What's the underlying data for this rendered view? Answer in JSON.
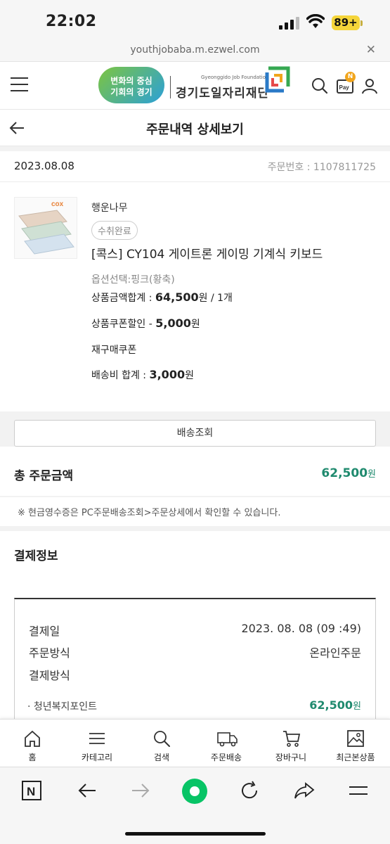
{
  "status_bar": {
    "time": "22:02",
    "battery": "89+"
  },
  "browser": {
    "url": "youthjobaba.m.ezwel.com",
    "close": "✕"
  },
  "header": {
    "logo_badge_line1": "변화의 중심",
    "logo_badge_line2": "기회의 경기",
    "logo_sub": "Gyeonggido Job Foundation",
    "logo_main": "경기도일자리재단",
    "pay_label": "Pay",
    "pay_badge": "N"
  },
  "page": {
    "title": "주문내역 상세보기"
  },
  "order": {
    "date": "2023.08.08",
    "number": "주문번호 : 1107811725"
  },
  "product": {
    "brand": "행운나무",
    "status": "수취완료",
    "thumb_logo": "cox",
    "name": "[콕스] CY104 게이트론 게이밍 기계식 키보드",
    "option": "옵션선택:핑크(황축)",
    "price_label": "상품금액합계 : ",
    "price_value": "64,500",
    "price_suffix": "원 / 1개",
    "coupon_label": "상품쿠폰할인 - ",
    "coupon_value": "5,000",
    "coupon_suffix": "원",
    "rebuy_coupon": "재구매쿠폰",
    "shipping_label": "배송비 합계 : ",
    "shipping_value": "3,000",
    "shipping_suffix": "원"
  },
  "shipping_button": "배송조회",
  "total": {
    "label": "총 주문금액",
    "value": "62,500",
    "unit": "원"
  },
  "notice": "※ 현금영수증은 PC주문배송조회>주문상세에서 확인할 수 있습니다.",
  "payment": {
    "title": "결제정보",
    "date_label": "결제일",
    "date_value": "2023. 08. 08 (09 :49)",
    "method_label": "주문방식",
    "method_value": "온라인주문",
    "pay_method_label": "결제방식",
    "point_label": "· 청년복지포인트",
    "point_value": "62,500",
    "point_unit": "원"
  },
  "bottom_nav": [
    {
      "label": "홈",
      "icon": "home-icon"
    },
    {
      "label": "카테고리",
      "icon": "menu-icon"
    },
    {
      "label": "검색",
      "icon": "search-icon"
    },
    {
      "label": "주문배송",
      "icon": "truck-icon"
    },
    {
      "label": "장바구니",
      "icon": "cart-icon"
    },
    {
      "label": "최근본상품",
      "icon": "image-icon"
    }
  ],
  "browser_bar": {
    "n_button": "N"
  },
  "colors": {
    "accent_green": "#1f8a6e",
    "battery_yellow": "#f5d53a",
    "browser_green": "#08c466"
  }
}
